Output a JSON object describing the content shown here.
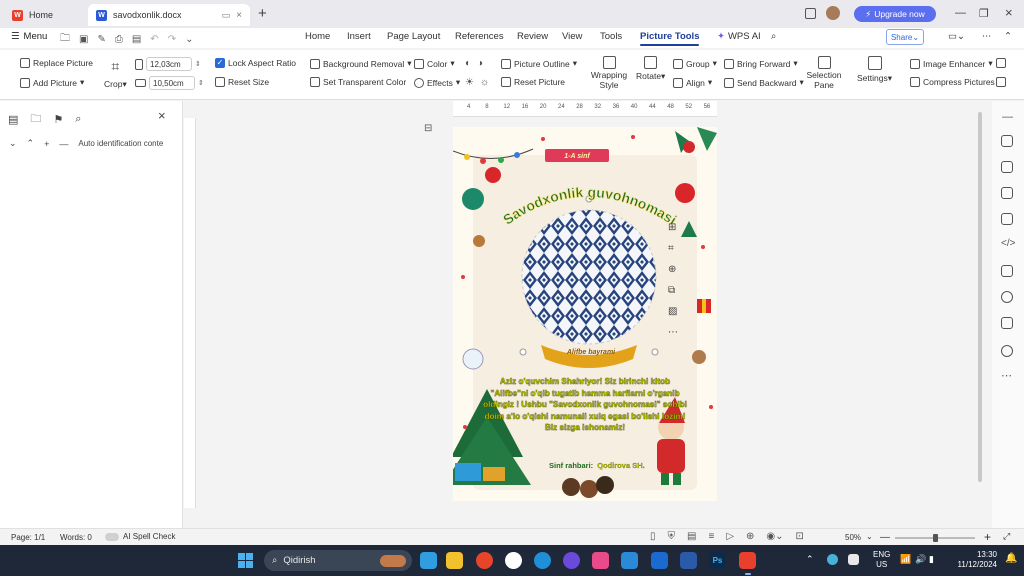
{
  "titlebar": {
    "tabs": [
      {
        "label": "Home",
        "logo": "W"
      },
      {
        "label": "savodxonlik.docx",
        "logo": "W"
      }
    ],
    "upgrade_label": "Upgrade now"
  },
  "menubar": {
    "menu_label": "Menu",
    "items": [
      "Home",
      "Insert",
      "Page Layout",
      "References",
      "Review",
      "View",
      "Tools",
      "Picture Tools",
      "WPS AI"
    ],
    "active": "Picture Tools",
    "share_label": "Share"
  },
  "toolbar": {
    "replace_picture": "Replace Picture",
    "add_picture": "Add Picture",
    "crop": "Crop",
    "width_value": "12,03cm",
    "height_value": "10,50cm",
    "lock_aspect": "Lock Aspect Ratio",
    "reset_size": "Reset Size",
    "background_removal": "Background Removal",
    "set_transparent": "Set Transparent Color",
    "color": "Color",
    "effects": "Effects",
    "picture_outline": "Picture Outline",
    "reset_picture": "Reset Picture",
    "wrapping_style": "Wrapping Style",
    "rotate": "Rotate",
    "group": "Group",
    "align": "Align",
    "bring_forward": "Bring Forward",
    "send_backward": "Send Backward",
    "selection_pane": "Selection Pane",
    "settings": "Settings",
    "image_enhancer": "Image Enhancer",
    "compress_pictures": "Compress Pictures"
  },
  "leftpanel": {
    "auto_identification": "Auto identification conte"
  },
  "ruler": {
    "marks": [
      "4",
      "8",
      "12",
      "16",
      "20",
      "24",
      "28",
      "32",
      "36",
      "40",
      "44",
      "48",
      "52",
      "56"
    ]
  },
  "document": {
    "badge": "1-A sinf",
    "title": "Savodxonlik guvohnomasi",
    "ribbon": "Alifbe bayrami",
    "body": "Aziz o'quvchim Shahriyor! Siz birinchi kitob \"Alifbe\"ni o'qib tugatib hamma harflarni o'rganib oldingiz ! Ushbu \"Savodxonlik guvohnomasi\" sohibi doim a'lo o'qishi namunali xulq egasi bo'lishi lozim! Biz sizga ishonamiz!",
    "teacher_label": "Sinf rahbari:",
    "teacher_name": "Qodirova SH."
  },
  "statusbar": {
    "page": "Page: 1/1",
    "words": "Words: 0",
    "spell_check": "AI Spell Check",
    "zoom": "50%"
  },
  "taskbar": {
    "search_placeholder": "Qidirish",
    "lang": "ENG",
    "region": "US",
    "time": "13:30",
    "date": "11/12/2024"
  },
  "colors": {
    "accent": "#1f3f9a",
    "upgrade": "#5b6ef0",
    "title_green": "#1f6b1f",
    "body_text": "#b8c400",
    "ribbon_gold": "#e2a21a"
  }
}
